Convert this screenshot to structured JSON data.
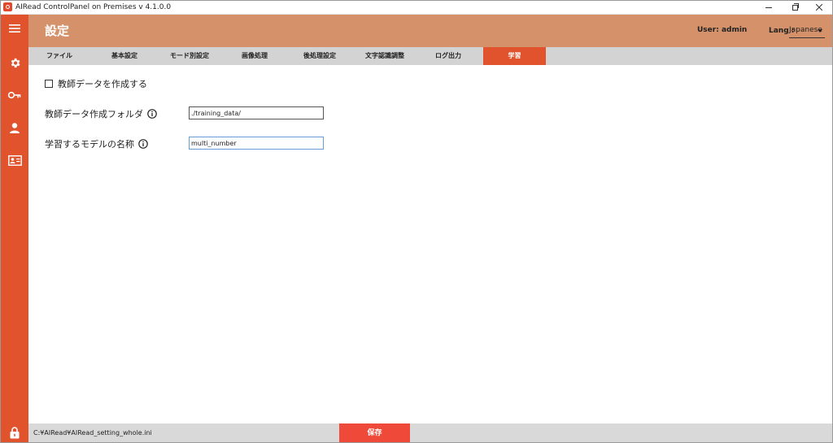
{
  "window": {
    "title": "AIRead ControlPanel on Premises v 4.1.0.0"
  },
  "header": {
    "title": "設定",
    "user_text": "User: admin",
    "lang_label": "Lang :",
    "lang_value": "Japanese"
  },
  "tabs": [
    {
      "label": "ファイル",
      "active": false
    },
    {
      "label": "基本設定",
      "active": false
    },
    {
      "label": "モード別設定",
      "active": false
    },
    {
      "label": "画像処理",
      "active": false
    },
    {
      "label": "後処理設定",
      "active": false
    },
    {
      "label": "文字認識調整",
      "active": false
    },
    {
      "label": "ログ出力",
      "active": false
    },
    {
      "label": "学習",
      "active": true
    }
  ],
  "form": {
    "checkbox_label": "教師データを作成する",
    "checkbox_checked": false,
    "folder_label": "教師データ作成フォルダ",
    "folder_value": "./training_data/",
    "model_label": "学習するモデルの名称",
    "model_value": "multi_number"
  },
  "footer": {
    "path": "C:¥AIRead¥AIRead_setting_whole.ini",
    "save_label": "保存"
  },
  "colors": {
    "accent": "#e0532c",
    "header_bg": "#d4916a",
    "save_button": "#ef4a39"
  },
  "icons": {
    "sidebar": [
      "menu-icon",
      "gear-icon",
      "key-icon",
      "user-icon",
      "id-card-icon",
      "lock-icon"
    ]
  }
}
